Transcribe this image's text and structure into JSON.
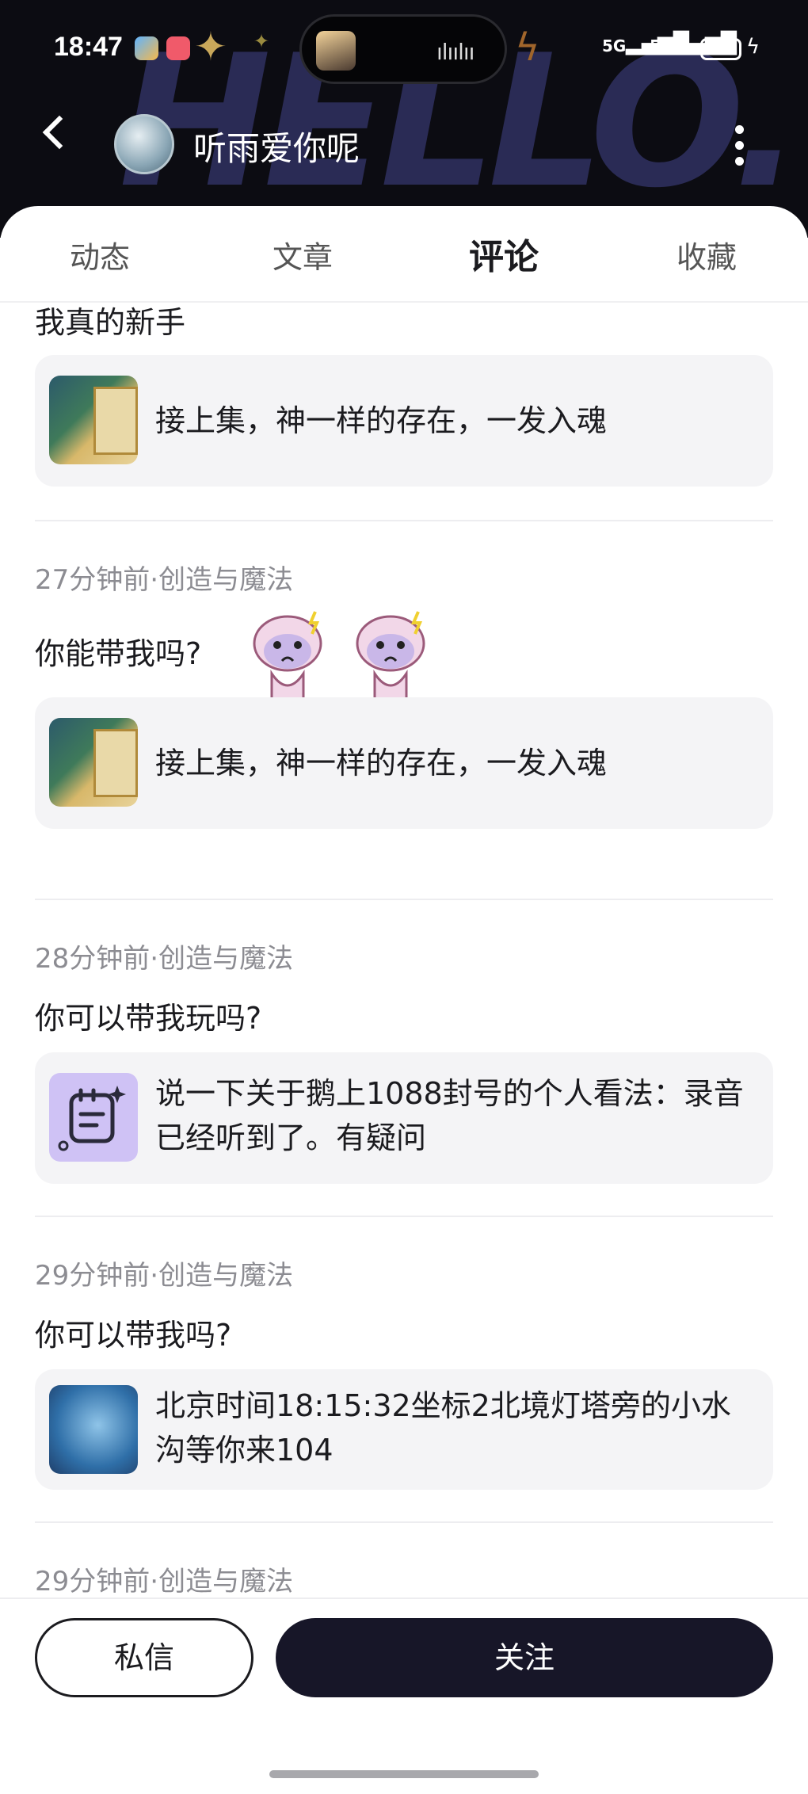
{
  "status_bar": {
    "time": "18:47",
    "battery": "19",
    "signal1": "5G",
    "signal2": "5G"
  },
  "header": {
    "brand_bg_text": "HELLO.",
    "username": "听雨爱你呢"
  },
  "tabs": [
    {
      "label": "动态"
    },
    {
      "label": "文章"
    },
    {
      "label": "评论",
      "active": true
    },
    {
      "label": "收藏"
    }
  ],
  "comments": [
    {
      "meta": "",
      "text": "我真的新手",
      "card_title": "接上集，神一样的存在，一发入魂",
      "thumb": "game-screenshot"
    },
    {
      "meta": "27分钟前·创造与魔法",
      "text": "你能带我吗?",
      "card_title": "接上集，神一样的存在，一发入魂",
      "thumb": "game-screenshot",
      "stickers": 2
    },
    {
      "meta": "28分钟前·创造与魔法",
      "text": "你可以带我玩吗?",
      "card_title": "说一下关于鹅上1088封号的个人看法：录音已经听到了。有疑问",
      "thumb": "note-icon"
    },
    {
      "meta": "29分钟前·创造与魔法",
      "text": "你可以带我吗?",
      "card_title": "北京时间18:15:32坐标2北境灯塔旁的小水沟等你来104",
      "thumb": "sea-screenshot"
    },
    {
      "meta": "29分钟前·创造与魔法"
    }
  ],
  "actions": {
    "dm_label": "私信",
    "follow_label": "关注"
  },
  "colors": {
    "header_bg": "#0c0c12",
    "follow_bg": "#171628",
    "tab_highlight": "#c9b5ff",
    "card_bg": "#f4f4f6"
  }
}
